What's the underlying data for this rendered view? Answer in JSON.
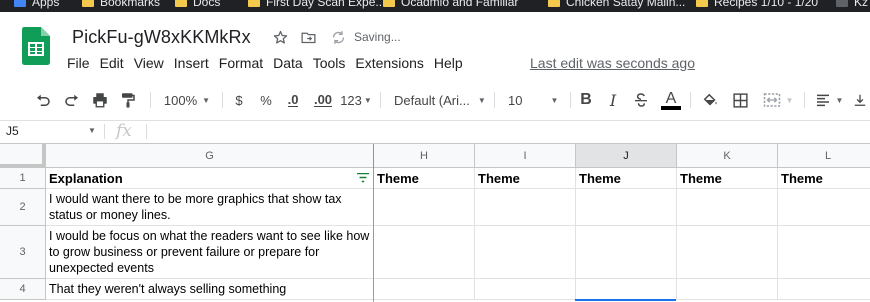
{
  "bookmarks": [
    {
      "label": "Apps"
    },
    {
      "label": "Bookmarks"
    },
    {
      "label": "Docs"
    },
    {
      "label": "First Day Scan Expe..."
    },
    {
      "label": "Ocadmio and Familiar"
    },
    {
      "label": "Chicken Satay Malin..."
    },
    {
      "label": "Recipes 1/10 - 1/20"
    },
    {
      "label": "Kz"
    }
  ],
  "document": {
    "title": "PickFu-gW8xKKMkRx",
    "status": "Saving...",
    "last_edit": "Last edit was seconds ago"
  },
  "menu": [
    "File",
    "Edit",
    "View",
    "Insert",
    "Format",
    "Data",
    "Tools",
    "Extensions",
    "Help"
  ],
  "toolbar": {
    "zoom": "100%",
    "currency": "$",
    "percent": "%",
    "decrease_decimal": ".0",
    "increase_decimal": ".00",
    "more_formats": "123",
    "font": "Default (Ari...",
    "font_size": "10",
    "bold": "B",
    "italic": "I",
    "text_color": "A"
  },
  "formula_bar": {
    "cell_ref": "J5",
    "fx": "fx",
    "content": ""
  },
  "columns": [
    "G",
    "H",
    "I",
    "J",
    "K",
    "L"
  ],
  "selected_column": "J",
  "rows": [
    {
      "num": "1",
      "G": "Explanation",
      "H": "Theme",
      "I": "Theme",
      "J": "Theme",
      "K": "Theme",
      "L": "Theme"
    },
    {
      "num": "2",
      "G": "I would want there to be more graphics that show tax status or money lines.",
      "H": "",
      "I": "",
      "J": "",
      "K": "",
      "L": ""
    },
    {
      "num": "3",
      "G": "I would be focus on what the readers want to see like how to grow business or prevent failure or prepare for unexpected events",
      "H": "",
      "I": "",
      "J": "",
      "K": "",
      "L": ""
    },
    {
      "num": "4",
      "G": "That they weren't always selling something",
      "H": "",
      "I": "",
      "J": "",
      "K": "",
      "L": ""
    }
  ],
  "colors": {
    "sheets_green": "#0f9d58",
    "selection_blue": "#1a73e8",
    "header_bg": "#f8f9fa"
  }
}
